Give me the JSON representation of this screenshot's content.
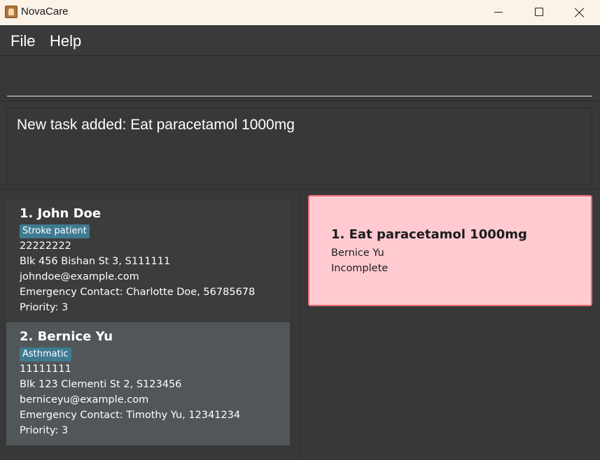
{
  "window": {
    "title": "NovaCare",
    "app_icon": "address-book-icon"
  },
  "menu": {
    "items": [
      "File",
      "Help"
    ]
  },
  "command": {
    "value": ""
  },
  "result": {
    "message": "New task added: Eat paracetamol 1000mg"
  },
  "persons": [
    {
      "index_name": "1. John Doe",
      "tag": "Stroke patient",
      "phone": "22222222",
      "address": "Blk 456 Bishan St 3, S111111",
      "email": "johndoe@example.com",
      "emergency": "Emergency Contact: Charlotte Doe, 56785678",
      "priority": "Priority: 3"
    },
    {
      "index_name": "2. Bernice Yu",
      "tag": "Asthmatic",
      "phone": "11111111",
      "address": "Blk 123 Clementi St 2, S123456",
      "email": "berniceyu@example.com",
      "emergency": "Emergency Contact: Timothy Yu, 12341234",
      "priority": "Priority: 3"
    }
  ],
  "tasks": [
    {
      "title": "1. Eat paracetamol 1000mg",
      "person": "Bernice Yu",
      "status": "Incomplete"
    }
  ],
  "colors": {
    "tag": "#3e7b91",
    "task_card_bg": "#ffcbd1",
    "task_card_border": "#f06a78",
    "selected_person": "#515658"
  }
}
